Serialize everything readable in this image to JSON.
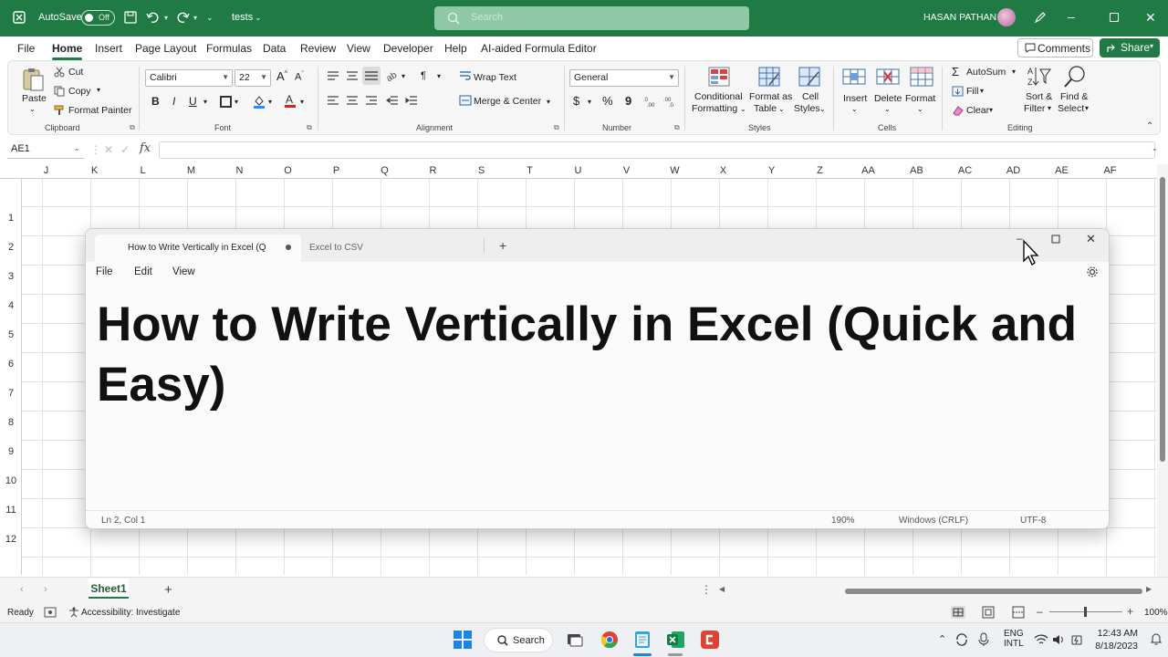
{
  "titlebar": {
    "autosave_label": "AutoSave",
    "autosave_state": "Off",
    "filename": "tests",
    "search_placeholder": "Search",
    "user_name": "HASAN PATHAN",
    "accent_color": "#1f7a43"
  },
  "menu": {
    "tabs": [
      "File",
      "Home",
      "Insert",
      "Page Layout",
      "Formulas",
      "Data",
      "Review",
      "View",
      "Developer",
      "Help",
      "AI-aided Formula Editor"
    ],
    "active": "Home",
    "comments_label": "Comments",
    "share_label": "Share"
  },
  "ribbon": {
    "clipboard": {
      "paste": "Paste",
      "cut": "Cut",
      "copy": "Copy",
      "format_painter": "Format Painter",
      "label": "Clipboard"
    },
    "font": {
      "family": "Calibri",
      "size": "22",
      "label": "Font",
      "bold": "B",
      "italic": "I",
      "underline": "U"
    },
    "alignment": {
      "wrap_text": "Wrap Text",
      "merge_center": "Merge & Center",
      "label": "Alignment"
    },
    "number": {
      "format": "General",
      "label": "Number",
      "currency": "$",
      "percent": "%",
      "comma": "9"
    },
    "styles": {
      "conditional": "Conditional",
      "formatting": "Formatting",
      "format_as": "Format as",
      "table": "Table",
      "cell": "Cell",
      "cell_styles": "Styles",
      "label": "Styles"
    },
    "cells": {
      "insert": "Insert",
      "delete": "Delete",
      "format": "Format",
      "label": "Cells"
    },
    "editing": {
      "autosum": "AutoSum",
      "fill": "Fill",
      "clear": "Clear",
      "sort": "Sort &",
      "filter": "Filter",
      "find": "Find &",
      "select": "Select",
      "label": "Editing"
    }
  },
  "formula_bar": {
    "name_box": "AE1",
    "fx": "fx",
    "value": ""
  },
  "columns": [
    "J",
    "K",
    "L",
    "M",
    "N",
    "O",
    "P",
    "Q",
    "R",
    "S",
    "T",
    "U",
    "V",
    "W",
    "X",
    "Y",
    "Z",
    "AA",
    "AB",
    "AC",
    "AD",
    "AE",
    "AF"
  ],
  "rows": [
    "1",
    "2",
    "3",
    "4",
    "5",
    "6",
    "7",
    "8",
    "9",
    "10",
    "11",
    "12"
  ],
  "sheets": {
    "tabs": [
      "Sheet1"
    ],
    "add": "+"
  },
  "status": {
    "ready": "Ready",
    "accessibility": "Accessibility: Investigate",
    "zoom": "100%"
  },
  "notepad": {
    "tabs": [
      "How to Write Vertically in Excel (Q",
      "Excel to CSV"
    ],
    "new_tab": "+",
    "menu": [
      "File",
      "Edit",
      "View"
    ],
    "content_line1": "How to Write Vertically in Excel (Quick and",
    "content_line2": "Easy)",
    "status": {
      "position": "Ln 2, Col 1",
      "zoom": "190%",
      "line_ending": "Windows (CRLF)",
      "encoding": "UTF-8"
    }
  },
  "taskbar": {
    "search_label": "Search",
    "lang_line1": "ENG",
    "lang_line2": "INTL",
    "time": "12:43 AM",
    "date": "8/18/2023"
  }
}
